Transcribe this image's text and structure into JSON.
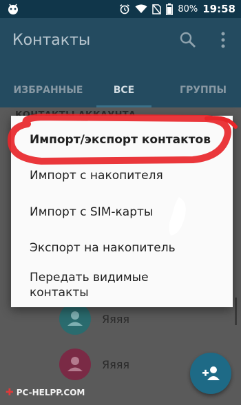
{
  "status_bar": {
    "left_icon": "android-icon",
    "icons": [
      "alarm-icon",
      "wifi-icon",
      "no-sim-icon",
      "battery-icon"
    ],
    "battery": "80%",
    "time": "19:58"
  },
  "appbar": {
    "title": "Контакты",
    "search_icon": "search-icon",
    "more_icon": "more-vert-icon"
  },
  "tabs": [
    {
      "label": "ИЗБРАННЫЕ",
      "active": false
    },
    {
      "label": "ВСЕ",
      "active": true
    },
    {
      "label": "ГРУППЫ",
      "active": false
    }
  ],
  "section_header": "КОНТАКТЫ АККАУНТА",
  "contacts": [
    {
      "name": "Яяяя",
      "color": "#2a6b6e"
    },
    {
      "name": "Яяяя",
      "color": "#7a2a45"
    }
  ],
  "menu": {
    "items": [
      {
        "label": "Импорт/экспорт контактов"
      },
      {
        "label": "Импорт с накопителя"
      },
      {
        "label": "Импорт с SIM-карты"
      },
      {
        "label": "Экспорт на накопитель"
      },
      {
        "label": "Передать видимые\nконтакты"
      }
    ]
  },
  "fab": {
    "icon": "add-person-icon"
  },
  "watermark": {
    "text": "PC-HELPP.COM"
  },
  "colors": {
    "status_bar": "#10364a",
    "appbar": "#244b60",
    "fab": "#1e6a86",
    "highlight": "#e8262a"
  }
}
